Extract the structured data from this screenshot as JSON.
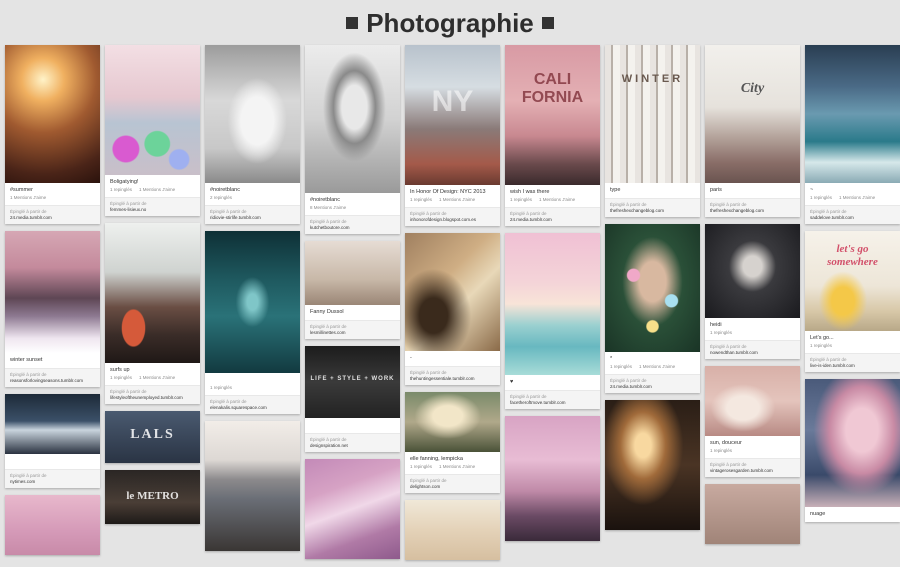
{
  "page": {
    "title": "Photographie",
    "attribution_label": "Épinglé à partir de"
  },
  "columns": [
    [
      {
        "caption": "#summer",
        "stats": [
          "1 Mentions J'aime"
        ],
        "source": "24.media.tumblr.com"
      },
      {
        "caption": "winter sunset",
        "stats": [],
        "source": "reasonsforlovingseasons.tumblr.com"
      },
      {
        "caption": "",
        "stats": [],
        "source": "nytimes.com"
      },
      {
        "caption": null
      }
    ],
    [
      {
        "caption": "Boligatying!",
        "stats": [
          "1 repinglés",
          "1 Mentions J'aime"
        ],
        "source": "femmes-lisieux.no"
      },
      {
        "caption": "surfs up",
        "stats": [
          "1 repinglés",
          "1 Mentions J'aime"
        ],
        "source": "lifestyleoftheunemployed.tumblr.com"
      },
      {
        "caption": null,
        "overlay": "LALS"
      },
      {
        "caption": null,
        "overlay": "le METRO"
      }
    ],
    [
      {
        "caption": "#noiretblanc",
        "stats": [
          "2 repinglés"
        ],
        "source": "ridiovie-stirlife.tumblr.com"
      },
      {
        "caption": "",
        "stats": [
          "1 repinglés"
        ],
        "source": "elenakalis.squarespace.com"
      },
      {
        "caption": null
      }
    ],
    [
      {
        "caption": "#noiretblanc",
        "stats": [
          "8 Mentions J'aime"
        ],
        "source": "kutchetboutore.com"
      },
      {
        "caption": "Fanny Dussol",
        "stats": [],
        "source": "lesmillinettes.com"
      },
      {
        "caption": "",
        "stats": [],
        "source": "designspiration.net",
        "overlay": "LIFE + STYLE + WORK"
      },
      {
        "caption": null
      }
    ],
    [
      {
        "caption": "In Honor Of Design: NYC 2013",
        "stats": [
          "1 repinglés",
          "1 Mentions J'aime"
        ],
        "source": "inhonorofdesign.blogspot.com.es",
        "overlay": "NY"
      },
      {
        "caption": "-",
        "stats": [],
        "source": "thehuntingessentiale.tumblr.com"
      },
      {
        "caption": "elle fanning, lempicka",
        "stats": [
          "1 repinglés",
          "1 Mentions J'aime"
        ],
        "source": "delightson.com"
      },
      {
        "caption": null
      }
    ],
    [
      {
        "caption": "wish I was there",
        "stats": [
          "1 repinglés",
          "1 Mentions J'aime"
        ],
        "source": "24.media.tumblr.com",
        "overlay": "CALI FORNIA"
      },
      {
        "caption": "♥",
        "stats": [],
        "source": "facetheroftmove.tumblr.com"
      },
      {
        "caption": null
      }
    ],
    [
      {
        "caption": "type",
        "stats": [],
        "source": "thefreshexchangeblog.com",
        "overlay": "WINTER"
      },
      {
        "caption": "*",
        "stats": [
          "1 repinglés",
          "1 Mentions J'aime"
        ],
        "source": "24.media.tumblr.com"
      },
      {
        "caption": null
      }
    ],
    [
      {
        "caption": "paris",
        "stats": [],
        "source": "thefreshexchangeblog.com",
        "overlay": "City"
      },
      {
        "caption": "heidi",
        "stats": [
          "1 repinglés"
        ],
        "source": "nowendthan.tumblr.com"
      },
      {
        "caption": "sun, douceur",
        "stats": [
          "1 repinglés"
        ],
        "source": "vintagerosesgarden.tumblr.com"
      },
      {
        "caption": null
      }
    ],
    [
      {
        "caption": "~",
        "stats": [
          "1 repinglés",
          "1 Mentions J'aime"
        ],
        "source": "saddelove.tumblr.com"
      },
      {
        "caption": "Let's go...",
        "stats": [
          "1 repinglés"
        ],
        "source": "live-is-iden.tumblr.com",
        "overlay": "let's go somewhere"
      },
      {
        "caption": "nuage",
        "stats": [],
        "source": ""
      }
    ]
  ],
  "colors": {
    "page_bg": "#e4e4e4",
    "card_bg": "#ffffff",
    "source_bg": "#f4f4f4",
    "title": "#2e2e2e"
  }
}
